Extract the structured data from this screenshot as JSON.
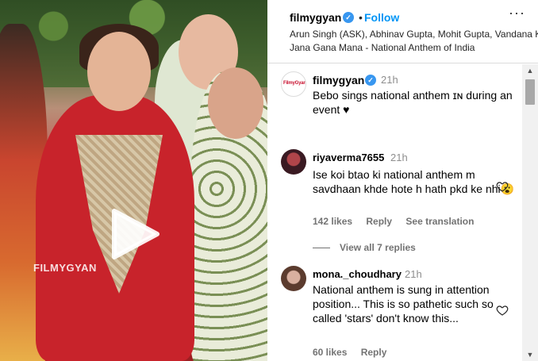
{
  "media": {
    "watermark": "FILMYGYAN"
  },
  "header": {
    "username": "filmygyan",
    "dot": "•",
    "follow_label": "Follow",
    "more_label": "···",
    "artists": "Arun Singh (ASK), Abhinav Gupta, Mohit Gupta, Vandana Ka",
    "song": "Jana Gana Mana - National Anthem of India"
  },
  "caption": {
    "avatar_text": "FilmyGyan",
    "username": "filmygyan",
    "time": "21h",
    "text": "Bebo sings national anthem ɪɴ during an event ♥"
  },
  "comments": [
    {
      "username": "riyaverma7655",
      "time": "21h",
      "text": "Ise koi btao ki national anthem m savdhaan khde hote h hath pkd ke nhi😮",
      "likes": "142 likes",
      "reply_label": "Reply",
      "translate_label": "See translation"
    },
    {
      "username": "mona._choudhary",
      "time": "21h",
      "text": "National anthem is sung in attention position... This is so pathetic such so called 'stars' don't know this...",
      "likes": "60 likes",
      "reply_label": "Reply"
    }
  ],
  "view_replies_label": "View all 7 replies",
  "colors": {
    "accent": "#0095f6",
    "verified": "#3897f0",
    "muted": "#737373"
  }
}
